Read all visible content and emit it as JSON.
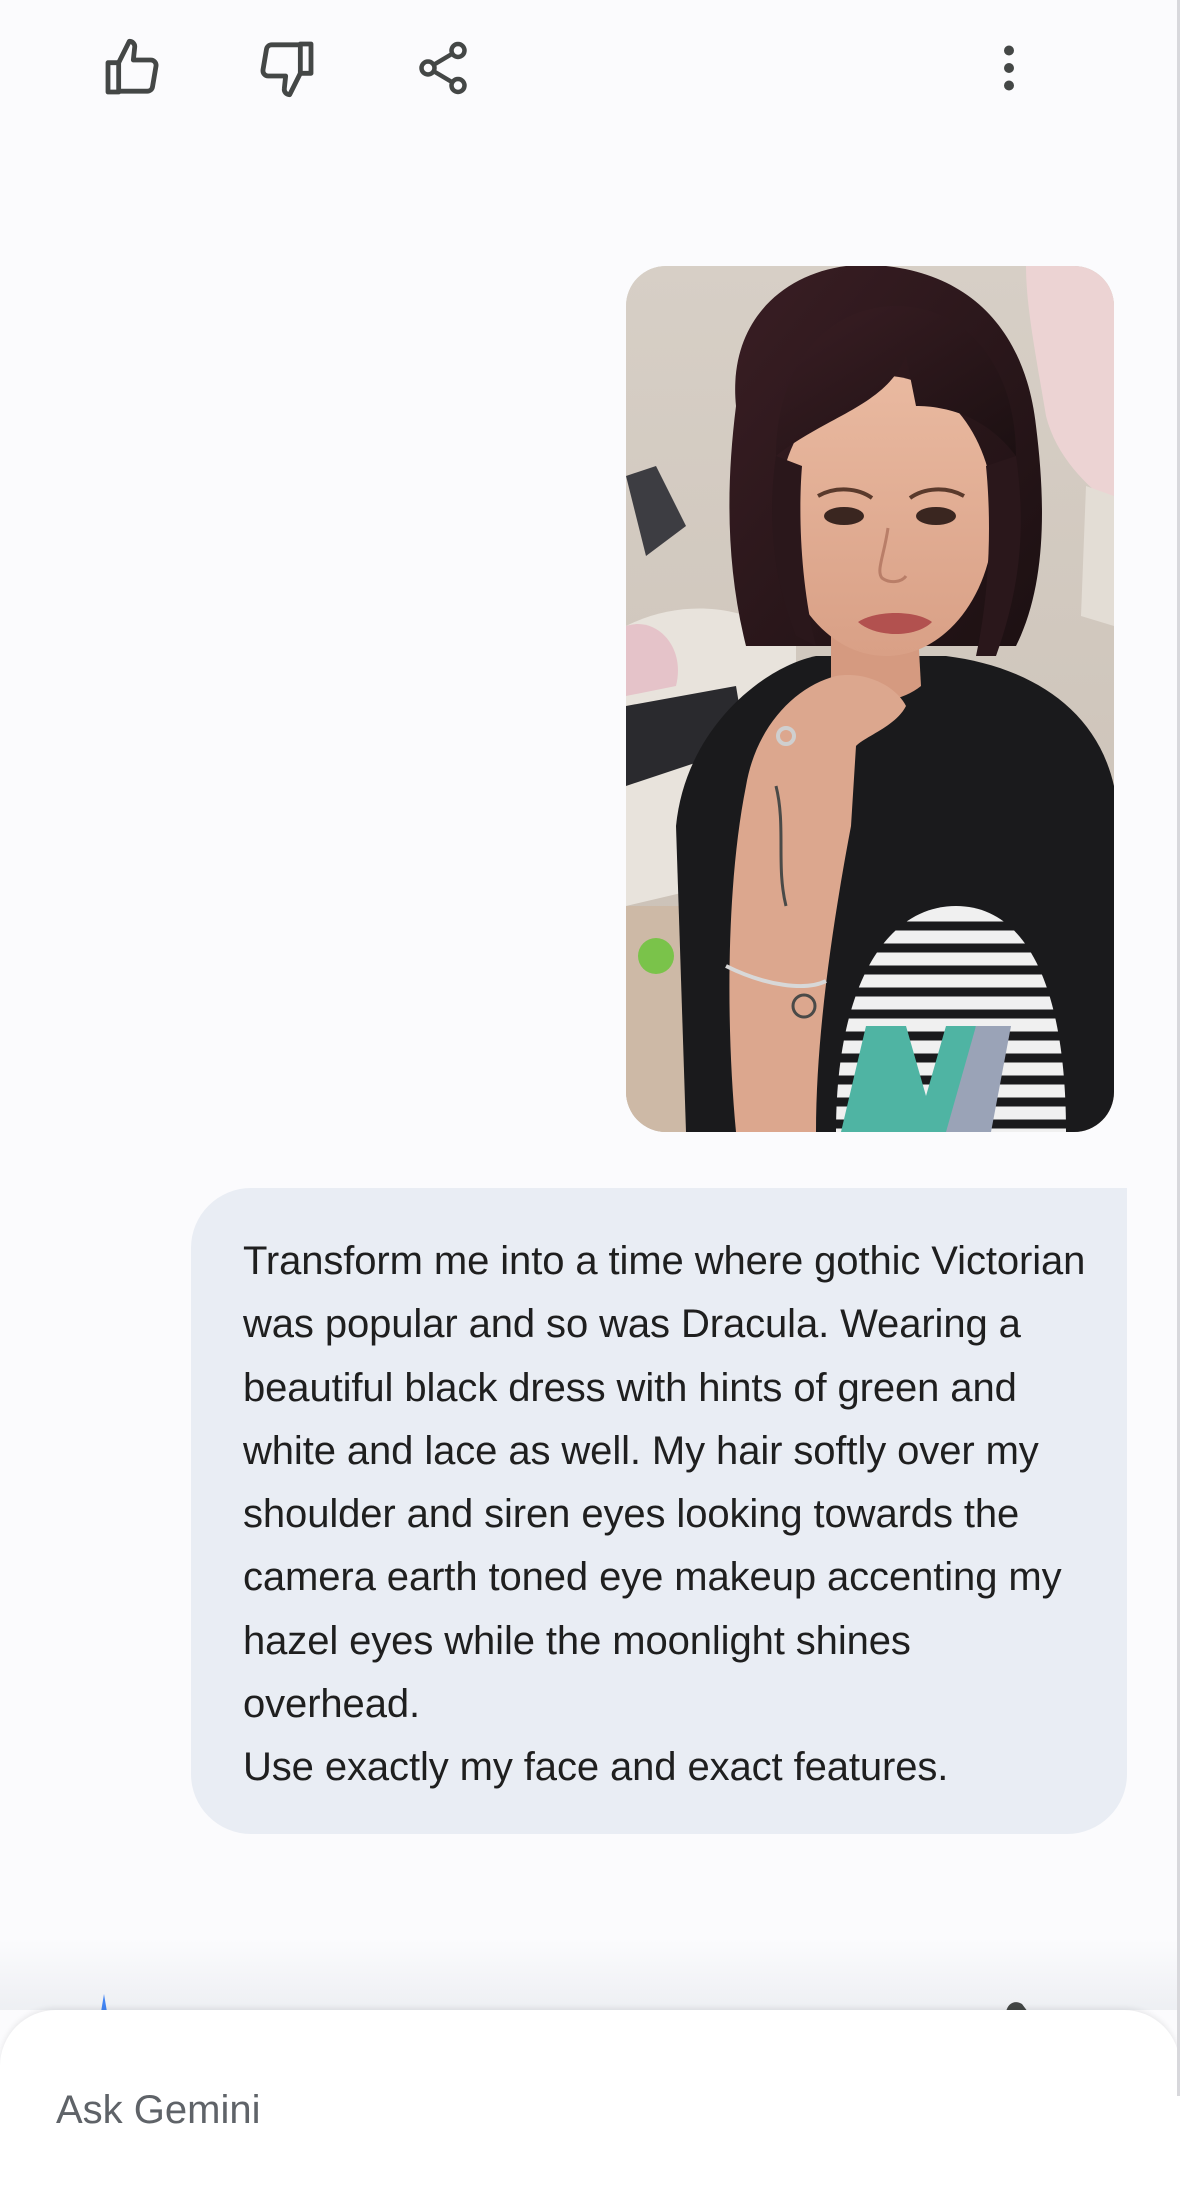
{
  "actions": {
    "like_icon": "thumb-up-icon",
    "dislike_icon": "thumb-down-icon",
    "share_icon": "share-icon",
    "more_icon": "more-vert-icon"
  },
  "attachment": {
    "type": "image",
    "subject": "selfie photo"
  },
  "prompt": {
    "text": "Transform me into a time where gothic Victorian was popular and so was Dracula. Wearing a beautiful black dress with hints of green and white and lace as well. My hair softly over my shoulder and siren eyes looking towards the camera earth toned eye makeup accenting my hazel eyes while the moonlight shines overhead.\nUse exactly my face and exact features."
  },
  "input": {
    "placeholder": "Ask Gemini"
  },
  "colors": {
    "bubble_bg": "#e9edf4",
    "page_bg": "#fbfbfd",
    "accent": "#4285f4"
  }
}
